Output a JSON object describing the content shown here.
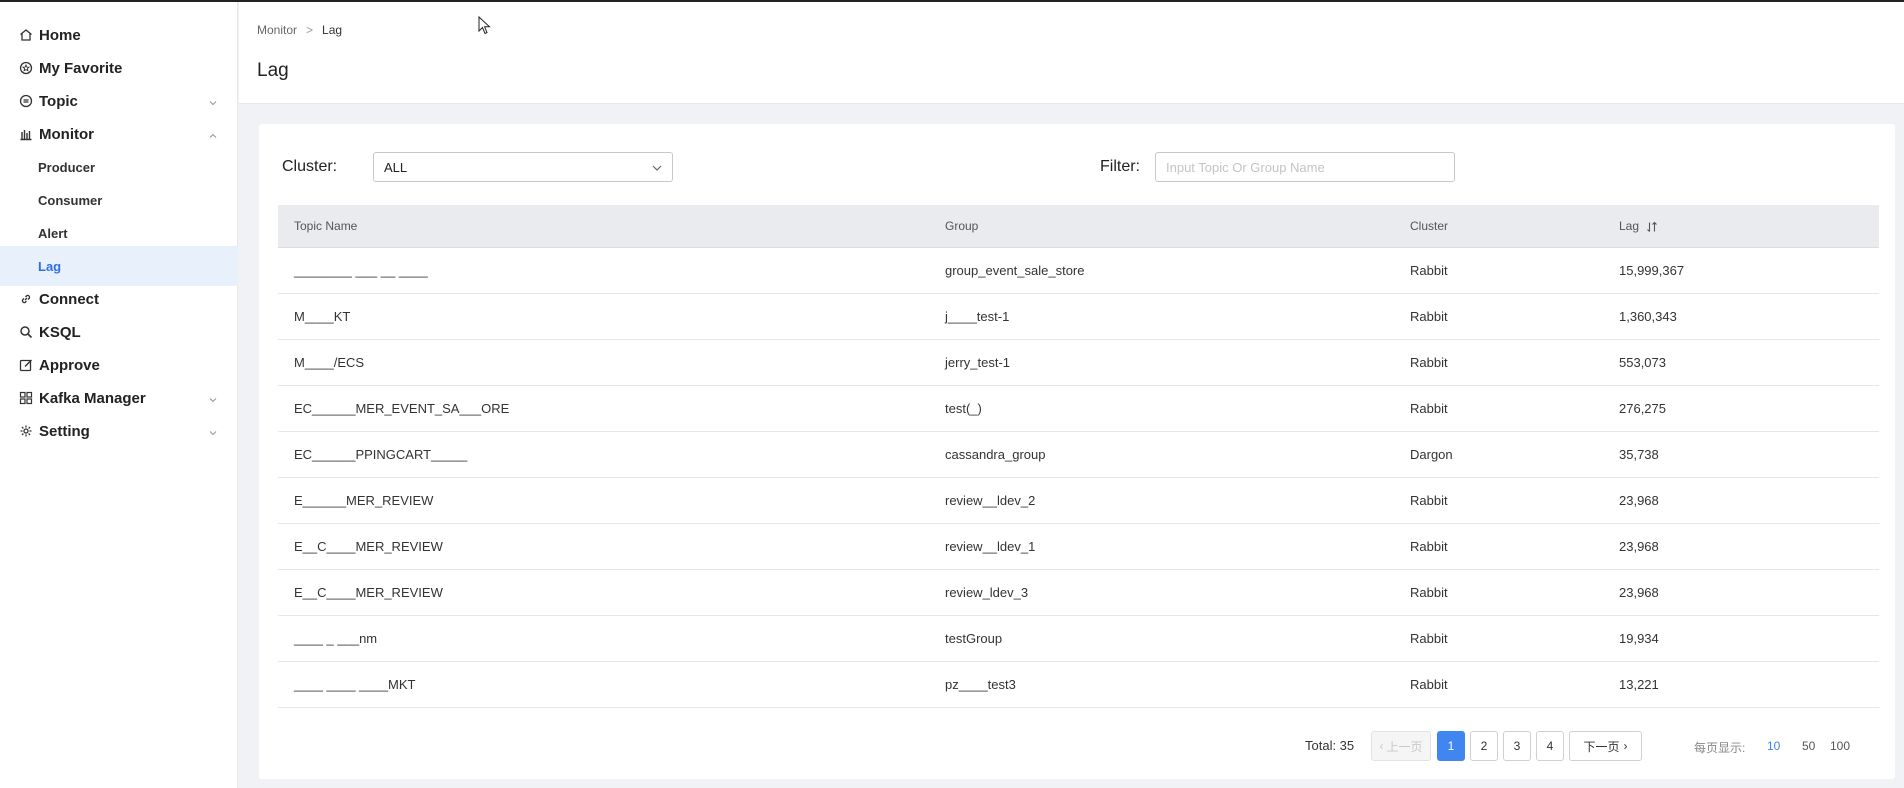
{
  "sidebar": {
    "items": [
      {
        "label": "Home",
        "icon": "home-icon"
      },
      {
        "label": "My Favorite",
        "icon": "favorite-icon"
      },
      {
        "label": "Topic",
        "icon": "topic-icon"
      },
      {
        "label": "Monitor",
        "icon": "monitor-icon"
      },
      {
        "label": "Producer"
      },
      {
        "label": "Consumer"
      },
      {
        "label": "Alert"
      },
      {
        "label": "Lag"
      },
      {
        "label": "Connect",
        "icon": "link-icon"
      },
      {
        "label": "KSQL",
        "icon": "search-icon"
      },
      {
        "label": "Approve",
        "icon": "edit-icon"
      },
      {
        "label": "Kafka Manager",
        "icon": "grid-icon"
      },
      {
        "label": "Setting",
        "icon": "setting-icon"
      }
    ]
  },
  "breadcrumb": {
    "parent": "Monitor",
    "current": "Lag",
    "separator": ">"
  },
  "page_title": "Lag",
  "filters": {
    "cluster_label": "Cluster:",
    "cluster_value": "ALL",
    "filter_label": "Filter:",
    "filter_placeholder": "Input Topic Or Group Name",
    "filter_value": ""
  },
  "table": {
    "headers": [
      "Topic Name",
      "Group",
      "Cluster",
      "Lag"
    ],
    "rows": [
      {
        "topic": "________ ___ __ ____",
        "group": "group_event_sale_store",
        "cluster": "Rabbit",
        "lag": "15,999,367"
      },
      {
        "topic": "M____KT",
        "group": "j____test-1",
        "cluster": "Rabbit",
        "lag": "1,360,343"
      },
      {
        "topic": "M____/ECS",
        "group": "jerry_test-1",
        "cluster": "Rabbit",
        "lag": "553,073"
      },
      {
        "topic": "EC______MER_EVENT_SA___ORE",
        "group": "test(_)",
        "cluster": "Rabbit",
        "lag": "276,275"
      },
      {
        "topic": "EC______PPINGCART_____",
        "group": "cassandra_group",
        "cluster": "Dargon",
        "lag": "35,738"
      },
      {
        "topic": "E______MER_REVIEW",
        "group": "review__ldev_2",
        "cluster": "Rabbit",
        "lag": "23,968"
      },
      {
        "topic": "E__C____MER_REVIEW",
        "group": "review__ldev_1",
        "cluster": "Rabbit",
        "lag": "23,968"
      },
      {
        "topic": "E__C____MER_REVIEW",
        "group": "review_ldev_3",
        "cluster": "Rabbit",
        "lag": "23,968"
      },
      {
        "topic": "____ _ ___nm",
        "group": "testGroup",
        "cluster": "Rabbit",
        "lag": "19,934"
      },
      {
        "topic": "____ ____ ____MKT",
        "group": "pz____test3",
        "cluster": "Rabbit",
        "lag": "13,221"
      }
    ]
  },
  "pagination": {
    "total": "Total: 35",
    "prev": "上一页",
    "next": "下一页",
    "pages": [
      "1",
      "2",
      "3",
      "4"
    ],
    "current": "1",
    "page_size_label": "每页显示:",
    "page_sizes": [
      "10",
      "50",
      "100"
    ],
    "current_size": "10"
  },
  "colors": {
    "accent": "#3f86f0",
    "active_menu_bg": "#e8f0fc",
    "header_bg": "#e9ebef"
  }
}
